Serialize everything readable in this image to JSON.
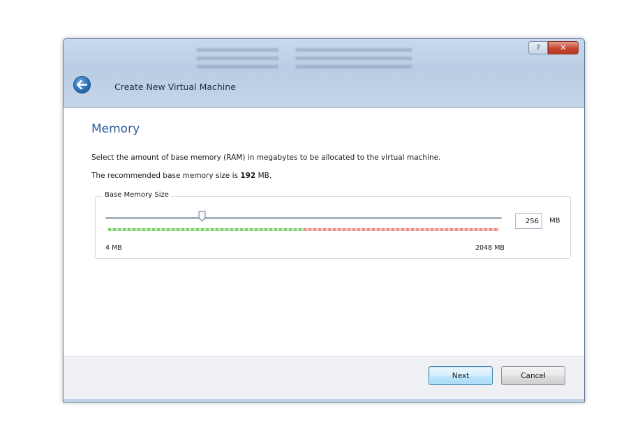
{
  "window": {
    "title": "Create New Virtual Machine",
    "help_glyph": "?",
    "close_glyph": "✕"
  },
  "page": {
    "heading": "Memory",
    "description": "Select the amount of base memory (RAM) in megabytes to be allocated to the virtual machine.",
    "recommended_prefix": "The recommended base memory size is ",
    "recommended_value": "192",
    "recommended_suffix": " MB."
  },
  "memory": {
    "group_title": "Base Memory Size",
    "value": "256",
    "unit": "MB",
    "min_label": "4 MB",
    "max_label": "2048 MB",
    "min_mb": 4,
    "max_mb": 2048,
    "current_mb": 256,
    "recommended_limit_fraction": 0.5
  },
  "buttons": {
    "next": "Next",
    "cancel": "Cancel"
  },
  "icons": {
    "back": "back-arrow-icon",
    "slider_thumb": "slider-thumb-icon"
  },
  "colors": {
    "heading": "#2d5c9b",
    "scale_ok": "#7dd46a",
    "scale_warn": "#ef8f8a"
  }
}
